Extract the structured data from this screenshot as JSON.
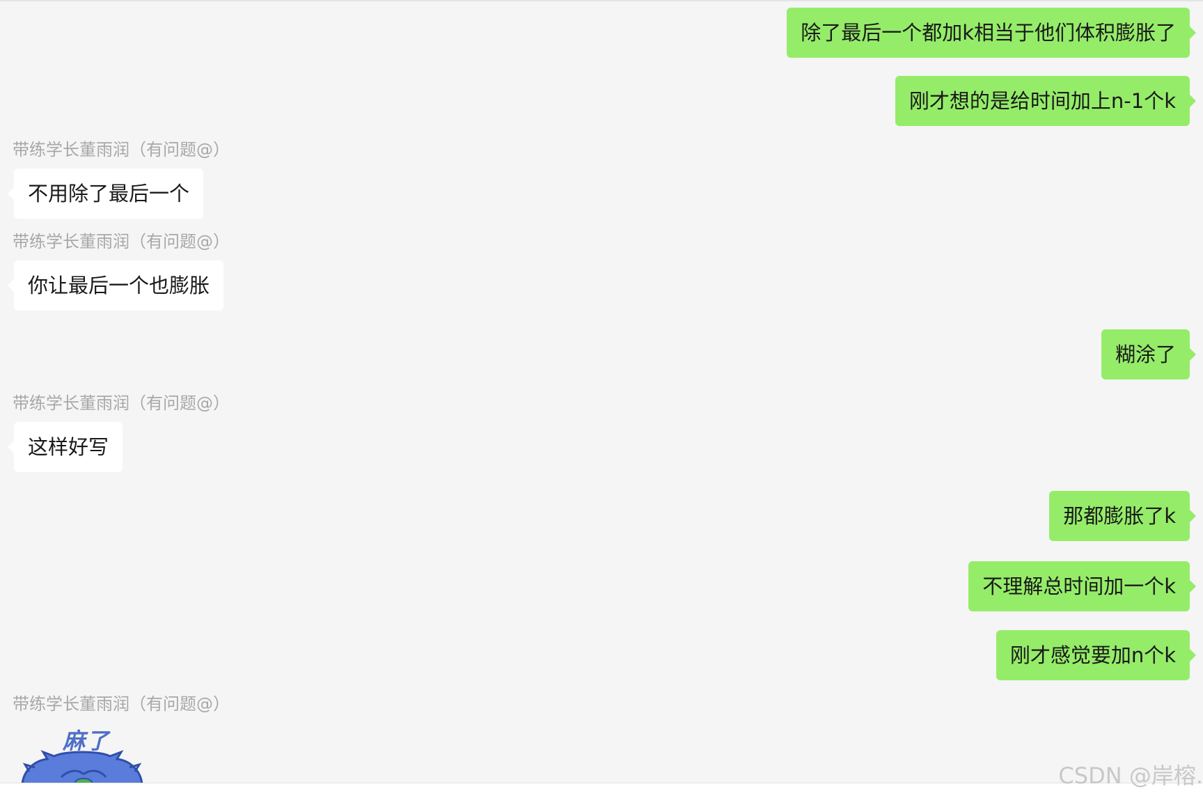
{
  "messages": {
    "m1": {
      "text": "除了最后一个都加k相当于他们体积膨胀了"
    },
    "m2": {
      "text": "刚才想的是给时间加上n-1个k"
    },
    "m3": {
      "sender": "带练学长董雨润（有问题@）",
      "text": "不用除了最后一个"
    },
    "m4": {
      "sender": "带练学长董雨润（有问题@）",
      "text": "你让最后一个也膨胀"
    },
    "m5": {
      "text": "糊涂了"
    },
    "m6": {
      "sender": "带练学长董雨润（有问题@）",
      "text": "这样好写"
    },
    "m7": {
      "text": "那都膨胀了k"
    },
    "m8": {
      "text": "不理解总时间加一个k"
    },
    "m9": {
      "text": "刚才感觉要加n个k"
    },
    "m10": {
      "sender": "带练学长董雨润（有问题@）",
      "sticker_text": "麻了"
    }
  },
  "watermark": "CSDN @岸榕.",
  "colors": {
    "chat_background": "#f5f5f5",
    "outgoing_bubble": "#95ec69",
    "incoming_bubble": "#ffffff",
    "sender_name": "#a8a8a8",
    "sticker_accent": "#4f6fc8"
  },
  "icons": {
    "sticker": "owl-sticker-icon"
  }
}
